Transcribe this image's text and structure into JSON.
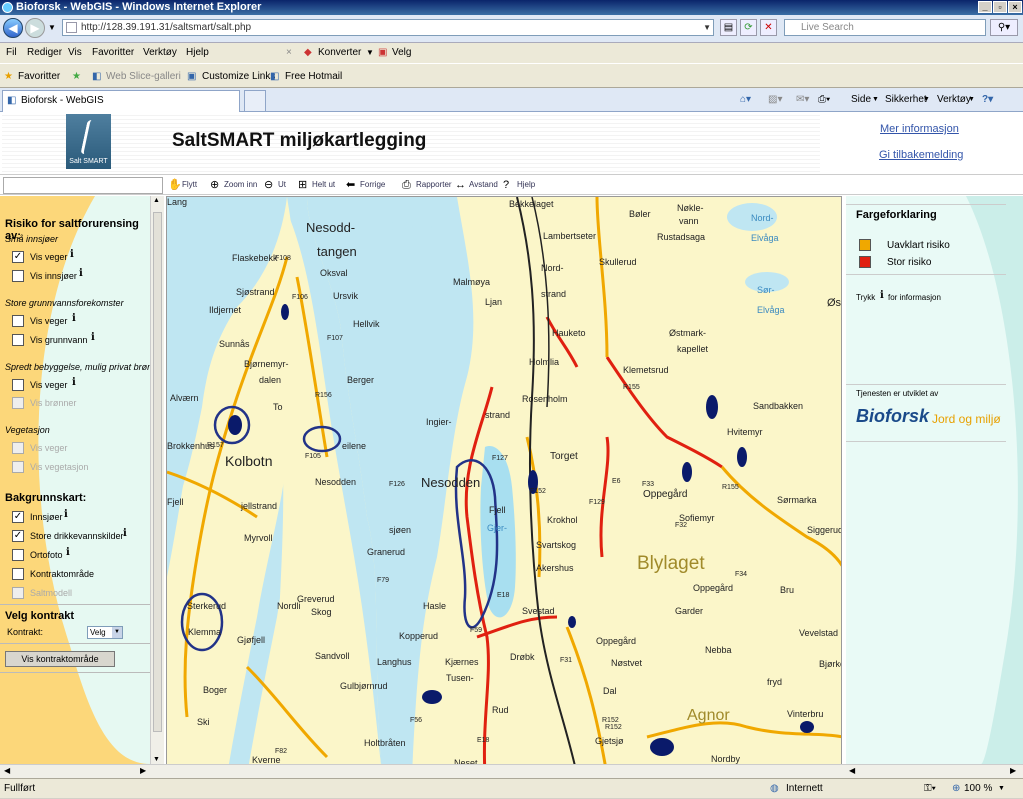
{
  "window": {
    "title": "Bioforsk - WebGIS - Windows Internet Explorer"
  },
  "address": {
    "url": "http://128.39.191.31/saltsmart/salt.php",
    "search_placeholder": "Live Search"
  },
  "menu": {
    "items": [
      "Fil",
      "Rediger",
      "Vis",
      "Favoritter",
      "Verktøy",
      "Hjelp"
    ],
    "convert": "Konverter",
    "select": "Velg"
  },
  "favbar": {
    "favorites": "Favoritter",
    "web_slice": "Web Slice-galleri",
    "customize": "Customize Links",
    "hotmail": "Free Hotmail"
  },
  "tabs": {
    "active": "Bioforsk - WebGIS",
    "cmd_side": "Side",
    "cmd_security": "Sikkerhet",
    "cmd_tools": "Verktøy"
  },
  "header": {
    "logo_text": "Salt SMART",
    "title": "SaltSMART miljøkartlegging",
    "more_info": "Mer informasjon",
    "feedback": "Gi tilbakemelding"
  },
  "toolbar": {
    "pan": "Flytt",
    "zoom_in": "Zoom inn",
    "zoom_out": "Ut",
    "zoom_all": "Helt ut",
    "prev": "Forrige",
    "report": "Rapporter",
    "distance": "Avstand",
    "help": "Hjelp"
  },
  "left": {
    "risk_title": "Risiko for saltforurensing av:",
    "lakes_sub": "Små innsjøer",
    "lakes_roads": "Vis veger",
    "lakes_lakes": "Vis innsjøer",
    "gw_sub": "Store grunnvannsforekomster",
    "gw_roads": "Vis veger",
    "gw_gw": "Vis grunnvann",
    "wells_sub": "Spredt bebyggelse, mulig privat brønn",
    "wells_roads": "Vis veger",
    "wells_wells": "Vis brønner",
    "veg_sub": "Vegetasjon",
    "veg_roads": "Vis veger",
    "veg_veg": "Vis vegetasjon",
    "base_title": "Bakgrunnskart:",
    "base_lakes": "Innsjøer",
    "base_water": "Store drikkevannskilder",
    "base_ortho": "Ortofoto",
    "base_contract": "Kontraktområde",
    "base_salt": "Saltmodell",
    "contract_title": "Velg kontrakt",
    "contract_label": "Kontrakt:",
    "contract_value": "Velg",
    "contract_button": "Vis kontraktområde"
  },
  "right": {
    "legend_title": "Fargeforklaring",
    "legend": [
      {
        "label": "Uavklart risiko",
        "color": "#f0a800"
      },
      {
        "label": "Stor risiko",
        "color": "#e02010"
      }
    ],
    "press_info": "Trykk",
    "press_info2": "for informasjon",
    "dev_by": "Tjenesten er utviklet av",
    "brand": "Bioforsk",
    "brand2": "Jord og miljø"
  },
  "map_labels": [
    "Bekkelaget",
    "Bøler",
    "Nøkle-",
    "vann",
    "Nord-",
    "Elvåga",
    "Lambertseter",
    "Rustadsaga",
    "Nesodd-",
    "tangen",
    "Flaskebekk",
    "Oksval",
    "Malmøya",
    "Nord-",
    "strand",
    "Skullerud",
    "Sjøstrand",
    "Ursvik",
    "Ljan",
    "Sør-",
    "Elvåga",
    "Øs",
    "Ildjernet",
    "Hellvik",
    "Hauketo",
    "Østmark-",
    "kapellet",
    "Sunnås",
    "Holmlia",
    "Bjørnemyr-",
    "dalen",
    "Berger",
    "Klemetsrud",
    "Alværn",
    "Rosenholm",
    "Sandbakken",
    "To",
    "Ingier-",
    "strand",
    "Hvitemyr",
    "Brokkenhus",
    "eilene",
    "Torget",
    "Kolbotn",
    "Nesodden",
    "Nesodden",
    "Oppegård",
    "Sørmarka",
    "Krokhol",
    "Sofiemyr",
    "Siggerud",
    "Fjell",
    "jellstrand",
    "Fjell",
    "Gjer-",
    "sjøen",
    "Svartskog",
    "Myrvoll",
    "Granerud",
    "Blylaget",
    "Akershus",
    "Greverud",
    "Hasle",
    "Oppegård",
    "Bru",
    "Nordli",
    "Skog",
    "Garder",
    "Sterkerud",
    "Svestad",
    "Oppegård",
    "Vevelstad",
    "Klemma",
    "Gjøfjell",
    "Kopperud",
    "Nebba",
    "Sandvoll",
    "Drøbk",
    "Nøstvet",
    "Langhus",
    "Kjærnes",
    "Tusen-",
    "fryd",
    "Boger",
    "Gulbjørnrud",
    "Dal",
    "Rud",
    "Agnor",
    "Vinterbru",
    "Ski",
    "Gjetsjø",
    "Kverne",
    "Holtbråten",
    "Neset",
    "Nordby",
    "Bjørke",
    "Lang"
  ],
  "map_roads": [
    "F108",
    "F106",
    "F107",
    "R156",
    "R157",
    "F105",
    "F126",
    "R155",
    "E6",
    "F129",
    "F33",
    "R155",
    "F32",
    "F34",
    "R152",
    "F152",
    "F127",
    "E18",
    "F59",
    "F56",
    "F31",
    "F29",
    "R154",
    "F82",
    "F78",
    "F79",
    "E18",
    "R152"
  ],
  "status": {
    "left": "Fullført",
    "zone": "Internett",
    "zoom": "100 %"
  }
}
